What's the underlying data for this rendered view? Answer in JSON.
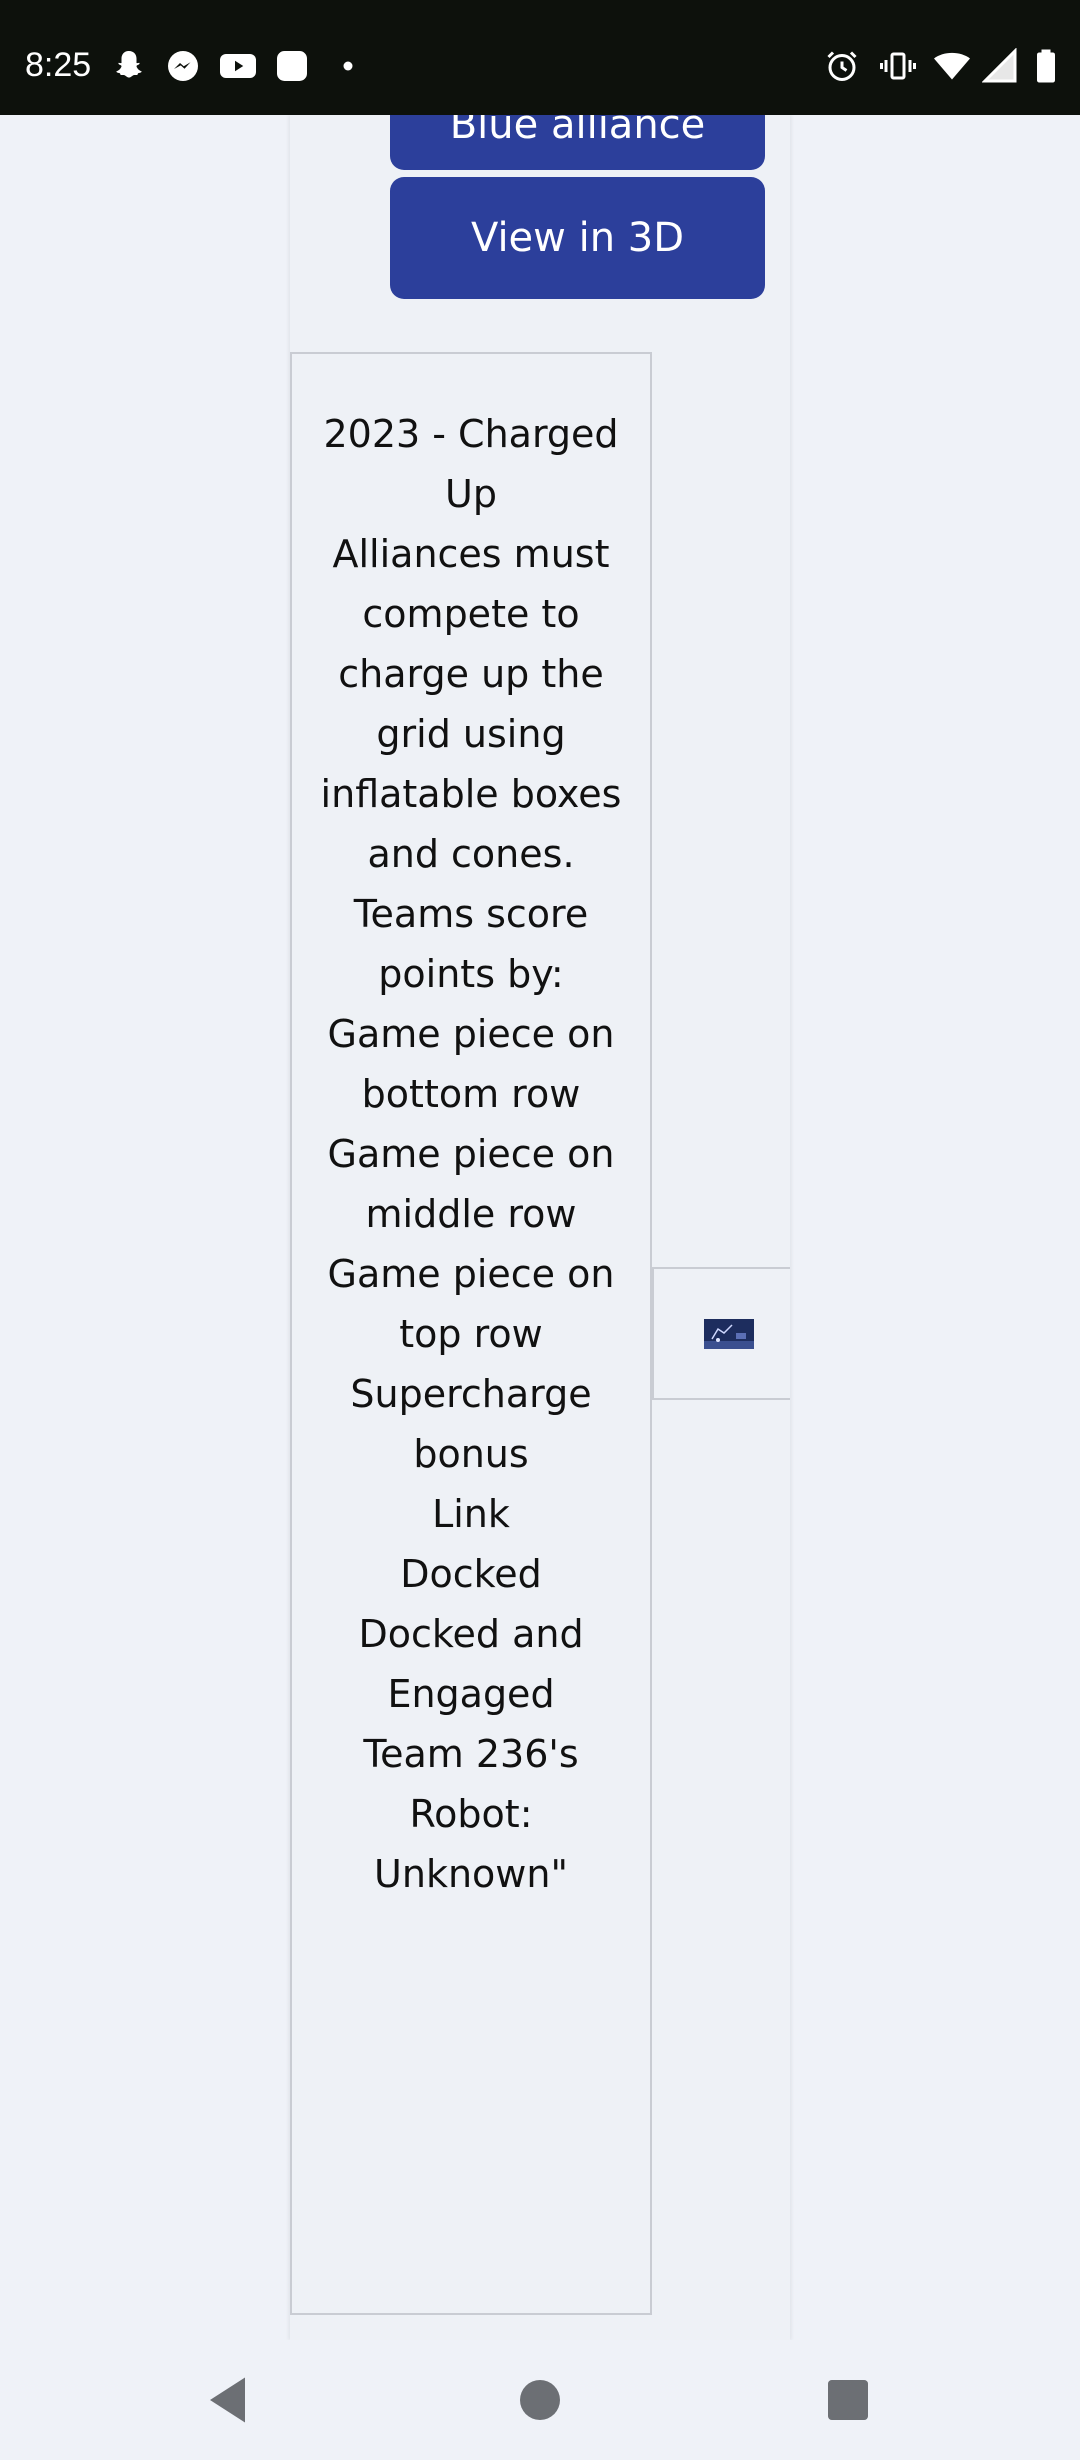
{
  "status_bar": {
    "time": "8:25",
    "left_icons": [
      "snapchat-icon",
      "messenger-icon",
      "youtube-icon",
      "app-icon",
      "dot-icon"
    ],
    "right_icons": [
      "alarm-icon",
      "vibrate-icon",
      "wifi-icon",
      "signal-icon",
      "battery-icon"
    ]
  },
  "buttons": {
    "blue_alliance": "Blue alliance",
    "view_3d": "View in 3D"
  },
  "description": {
    "lines": [
      "2023 - Charged Up",
      "Alliances must compete to charge up the grid using inflatable boxes and cones.",
      "Teams score points by:",
      "Game piece on bottom row",
      "Game piece on middle row",
      "Game piece on top row",
      "Supercharge bonus",
      "Link",
      "Docked",
      "Docked and Engaged",
      "Team 236's Robot: Unknown\""
    ]
  },
  "nav_bar": {
    "icons": [
      "back-icon",
      "home-icon",
      "recents-icon"
    ]
  },
  "colors": {
    "button_bg": "#2c3f9b",
    "page_bg": "#eff2f8",
    "status_bar_bg": "#0d110c"
  }
}
